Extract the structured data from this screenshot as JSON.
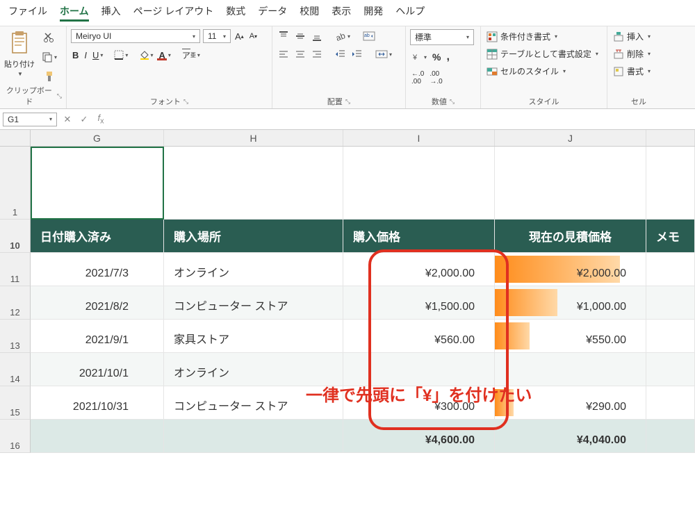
{
  "menu": {
    "file": "ファイル",
    "home": "ホーム",
    "insert": "挿入",
    "pagelayout": "ページ レイアウト",
    "formulas": "数式",
    "data": "データ",
    "review": "校閲",
    "view": "表示",
    "developer": "開発",
    "help": "ヘルプ"
  },
  "ribbon": {
    "paste": "貼り付け",
    "clipboard": "クリップボード",
    "fontName": "Meiryo UI",
    "fontSize": "11",
    "fontGroup": "フォント",
    "alignGroup": "配置",
    "numberFormat": "標準",
    "numberGroup": "数値",
    "condfmt": "条件付き書式",
    "tablefmt": "テーブルとして書式設定",
    "cellstyle": "セルのスタイル",
    "styleGroup": "スタイル",
    "insertBtn": "挿入",
    "deleteBtn": "削除",
    "formatBtn": "書式",
    "cellGroup": "セル"
  },
  "namebox": "G1",
  "columns": {
    "g": "G",
    "h": "H",
    "i": "I",
    "j": "J"
  },
  "rows": [
    "1",
    "10",
    "11",
    "12",
    "13",
    "14",
    "15",
    "16"
  ],
  "headers": {
    "date": "日付購入済み",
    "place": "購入場所",
    "price": "購入価格",
    "estimate": "現在の見積価格",
    "memo": "メモ"
  },
  "data": [
    {
      "date": "2021/7/3",
      "place": "オンライン",
      "price": "¥2,000.00",
      "estimate": "¥2,000.00",
      "bar": 100
    },
    {
      "date": "2021/8/2",
      "place": "コンピューター ストア",
      "price": "¥1,500.00",
      "estimate": "¥1,000.00",
      "bar": 50
    },
    {
      "date": "2021/9/1",
      "place": "家具ストア",
      "price": "¥560.00",
      "estimate": "¥550.00",
      "bar": 28
    },
    {
      "date": "2021/10/1",
      "place": "オンライン",
      "price": "",
      "estimate": "",
      "bar": 0
    },
    {
      "date": "2021/10/31",
      "place": "コンピューター ストア",
      "price": "¥300.00",
      "estimate": "¥290.00",
      "bar": 15
    }
  ],
  "totals": {
    "price": "¥4,600.00",
    "estimate": "¥4,040.00"
  },
  "annotation": "一律で先頭に「¥」を付けたい"
}
